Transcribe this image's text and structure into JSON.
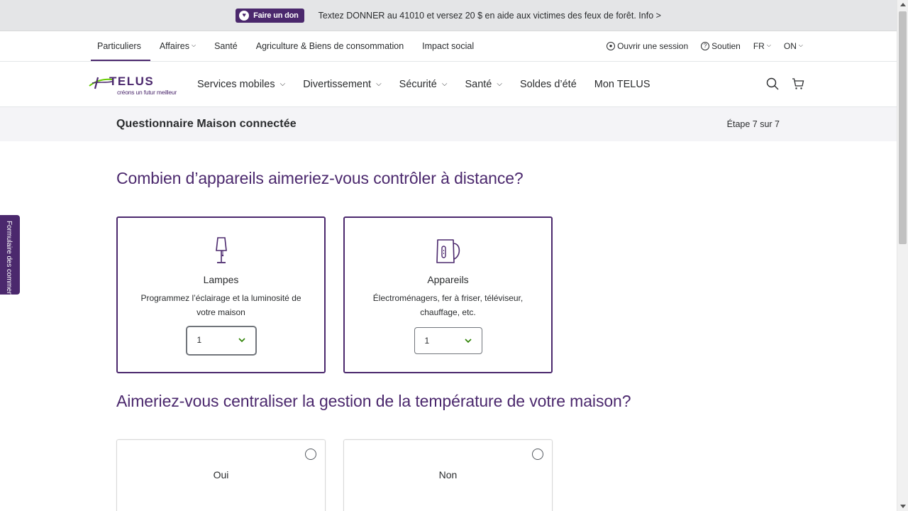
{
  "promo": {
    "donate_label": "Faire un don",
    "message": "Textez DONNER au 41010 et versez 20 $ en aide aux victimes des feux de forêt. Info >"
  },
  "utility_nav": {
    "items": [
      {
        "label": "Particuliers"
      },
      {
        "label": "Affaires"
      },
      {
        "label": "Santé"
      },
      {
        "label": "Agriculture & Biens de consommation"
      },
      {
        "label": "Impact social"
      }
    ],
    "sign_in": "Ouvrir une session",
    "support": "Soutien",
    "language": "FR",
    "region": "ON"
  },
  "brand": {
    "name": "TELUS",
    "tagline": "créons un futur meilleur",
    "color": "#4b286d",
    "accent": "#66cc00"
  },
  "main_nav": {
    "items": [
      {
        "label": "Services mobiles"
      },
      {
        "label": "Divertissement"
      },
      {
        "label": "Sécurité"
      },
      {
        "label": "Santé"
      },
      {
        "label": "Soldes d’été"
      },
      {
        "label": "Mon TELUS"
      }
    ]
  },
  "quiz": {
    "title": "Questionnaire Maison connectée",
    "step": "Étape 7 sur 7"
  },
  "feedback_tab": "Formulaire des comment",
  "question1": {
    "text": "Combien d’appareils aimeriez-vous contrôler à distance?",
    "cards": [
      {
        "title": "Lampes",
        "description": "Programmez l’éclairage et la luminosité de votre maison",
        "value": "1"
      },
      {
        "title": "Appareils",
        "description": "Électroménagers, fer à friser, téléviseur, chauffage, etc.",
        "value": "1"
      }
    ]
  },
  "question2": {
    "text": "Aimeriez-vous centraliser la gestion de la température de votre maison?",
    "options": [
      {
        "label": "Oui"
      },
      {
        "label": "Non"
      }
    ]
  }
}
